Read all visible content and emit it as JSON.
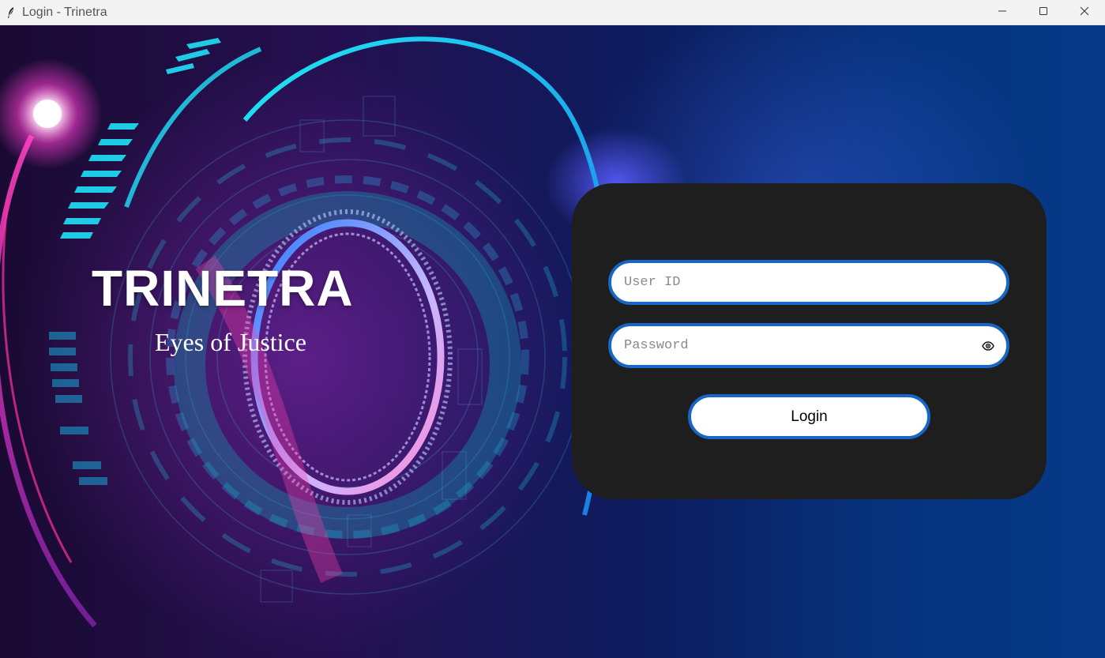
{
  "window": {
    "title": "Login - Trinetra",
    "controls": {
      "minimize": "minimize-icon",
      "maximize": "maximize-icon",
      "close": "close-icon"
    }
  },
  "brand": {
    "title": "TRINETRA",
    "subtitle": "Eyes of Justice"
  },
  "login": {
    "user_id": {
      "value": "",
      "placeholder": "User ID"
    },
    "password": {
      "value": "",
      "placeholder": "Password",
      "toggle_icon": "eye-icon"
    },
    "submit_label": "Login"
  },
  "colors": {
    "field_border": "#1866c6",
    "card_bg": "#1e1e1e",
    "accent_cyan": "#19e0ee",
    "accent_magenta": "#ff2fa8"
  }
}
